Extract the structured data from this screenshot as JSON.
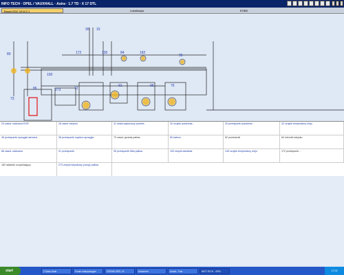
{
  "window": {
    "title": "INFO TECH · OPEL / VAUXHALL · Astra · 1.7 TD · X 17 DTL"
  },
  "tabs": [
    {
      "label": "Bosch EDC 15 M 2 1"
    },
    {
      "label": "Lokalizacja"
    },
    {
      "label": "EOBD"
    }
  ],
  "diagram": {
    "labels": [
      "80",
      "172",
      "130",
      "84",
      "182",
      "95",
      "100",
      "86",
      "72",
      "273",
      "73",
      "96",
      "30",
      "15",
      "91",
      "76"
    ]
  },
  "components": [
    [
      "23 zawór odcinania EGR",
      "28 zawór wtrysku",
      "31 układ zapłonowy przedni...",
      "32 czujnik położenia...",
      "33 przełącznik położenia...",
      "42 czujnik temperatury oleju"
    ],
    [
      "36 przełącznik sprzęgła hamulca",
      "38 przełącznik zapłonu sprzęgła",
      "73 zawór grzania paliwa",
      "80 świece",
      "82 przekaźnik",
      "84 mierniki wtrysku"
    ],
    [
      "86 zawór odcinania",
      "91 przełącznik",
      "95 przełącznik filtra paliwa",
      "100 zespół zasilania",
      "145 czujnik temperatury oleju",
      "172 przełącznik..."
    ],
    [
      "182 składnik uzupełniający",
      "273 zespół wtryskowy pompy paliwa",
      "",
      "",
      "",
      ""
    ]
  ],
  "taskbar": {
    "start": "start",
    "tasks": [
      "2 Gadu-Gadu",
      "Forum motoryzacyjne",
      "FORUM OPEL 24",
      "Dokument",
      "Kolorit - Foto",
      "INFO TECH - OPEL"
    ],
    "clock": "17:02"
  }
}
